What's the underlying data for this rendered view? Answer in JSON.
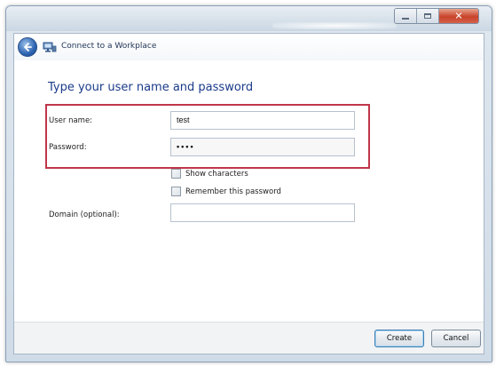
{
  "window": {
    "title": "Connect to a Workplace"
  },
  "form": {
    "heading": "Type your user name and password",
    "username_label": "User name:",
    "username_value": "test",
    "password_label": "Password:",
    "password_value": "••••",
    "show_characters_label": "Show characters",
    "show_characters_checked": false,
    "remember_password_label": "Remember this password",
    "remember_password_checked": false,
    "domain_label": "Domain (optional):",
    "domain_value": ""
  },
  "buttons": {
    "create": "Create",
    "cancel": "Cancel"
  },
  "colors": {
    "highlight": "#c0364a",
    "heading": "#1a3a8a"
  }
}
